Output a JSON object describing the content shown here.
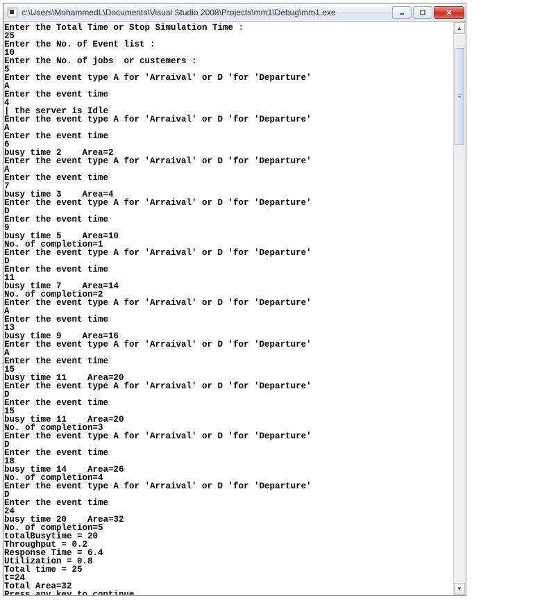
{
  "window": {
    "title": "c:\\Users\\MohammedL\\Documents\\Visual Studio 2008\\Projects\\mm1\\Debug\\mm1.exe"
  },
  "console": {
    "lines": [
      "Enter the Total Time or Stop Simulation Time :",
      "25",
      "Enter the No. of Event list :",
      "10",
      "Enter the No. of jobs  or custemers :",
      "5",
      "Enter the event type A for 'Arraival' or D 'for 'Departure'",
      "A",
      "Enter the event time",
      "4",
      "| the server is Idle",
      "Enter the event type A for 'Arraival' or D 'for 'Departure'",
      "A",
      "Enter the event time",
      "6",
      "busy time 2    Area=2",
      "Enter the event type A for 'Arraival' or D 'for 'Departure'",
      "A",
      "Enter the event time",
      "7",
      "busy time 3    Area=4",
      "Enter the event type A for 'Arraival' or D 'for 'Departure'",
      "D",
      "Enter the event time",
      "9",
      "busy time 5    Area=10",
      "No. of completion=1",
      "Enter the event type A for 'Arraival' or D 'for 'Departure'",
      "D",
      "Enter the event time",
      "11",
      "busy time 7    Area=14",
      "No. of completion=2",
      "Enter the event type A for 'Arraival' or D 'for 'Departure'",
      "A",
      "Enter the event time",
      "13",
      "busy time 9    Area=16",
      "Enter the event type A for 'Arraival' or D 'for 'Departure'",
      "A",
      "Enter the event time",
      "15",
      "busy time 11    Area=20",
      "Enter the event type A for 'Arraival' or D 'for 'Departure'",
      "D",
      "Enter the event time",
      "15",
      "busy time 11    Area=20",
      "No. of completion=3",
      "Enter the event type A for 'Arraival' or D 'for 'Departure'",
      "D",
      "Enter the event time",
      "18",
      "busy time 14    Area=26",
      "No. of completion=4",
      "Enter the event type A for 'Arraival' or D 'for 'Departure'",
      "D",
      "Enter the event time",
      "24",
      "busy time 20    Area=32",
      "No. of completion=5",
      "totalBusytime = 20",
      "Throughput = 0.2",
      "Response Time = 6.4",
      "Utilization = 0.8",
      "Total time = 25",
      "t=24",
      "Total Area=32",
      "Press any key to continue . . ."
    ]
  }
}
